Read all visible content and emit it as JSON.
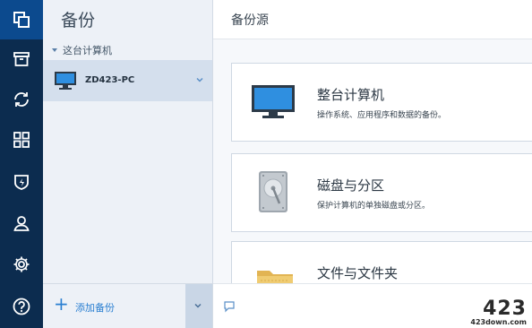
{
  "colors": {
    "rail_bg": "#0c2c4f",
    "rail_active": "#0c4a8e",
    "accent": "#2a7fd1",
    "panel_bg": "#edf1f7",
    "selected_bg": "#d4dfed"
  },
  "rail": {
    "items": [
      {
        "icon": "copy-backup-icon",
        "active": true
      },
      {
        "icon": "archive-icon",
        "active": false
      },
      {
        "icon": "sync-icon",
        "active": false
      },
      {
        "icon": "dashboard-icon",
        "active": false
      },
      {
        "icon": "shield-icon",
        "active": false
      },
      {
        "icon": "account-icon",
        "active": false
      },
      {
        "icon": "settings-icon",
        "active": false
      },
      {
        "icon": "help-icon",
        "active": false
      }
    ]
  },
  "panel": {
    "title": "备份",
    "group_label": "这台计算机",
    "device": {
      "name": "ZD423-PC",
      "icon": "monitor-icon"
    },
    "add_backup_label": "添加备份"
  },
  "main": {
    "title": "备份源",
    "cards": [
      {
        "title": "整台计算机",
        "desc": "操作系统、应用程序和数据的备份。",
        "icon": "monitor-icon"
      },
      {
        "title": "磁盘与分区",
        "desc": "保护计算机的单独磁盘或分区。",
        "icon": "hard-drive-icon"
      },
      {
        "title": "文件与文件夹",
        "desc": "",
        "icon": "folder-icon"
      }
    ]
  },
  "watermark": {
    "big": "423",
    "small": "423down.com"
  }
}
